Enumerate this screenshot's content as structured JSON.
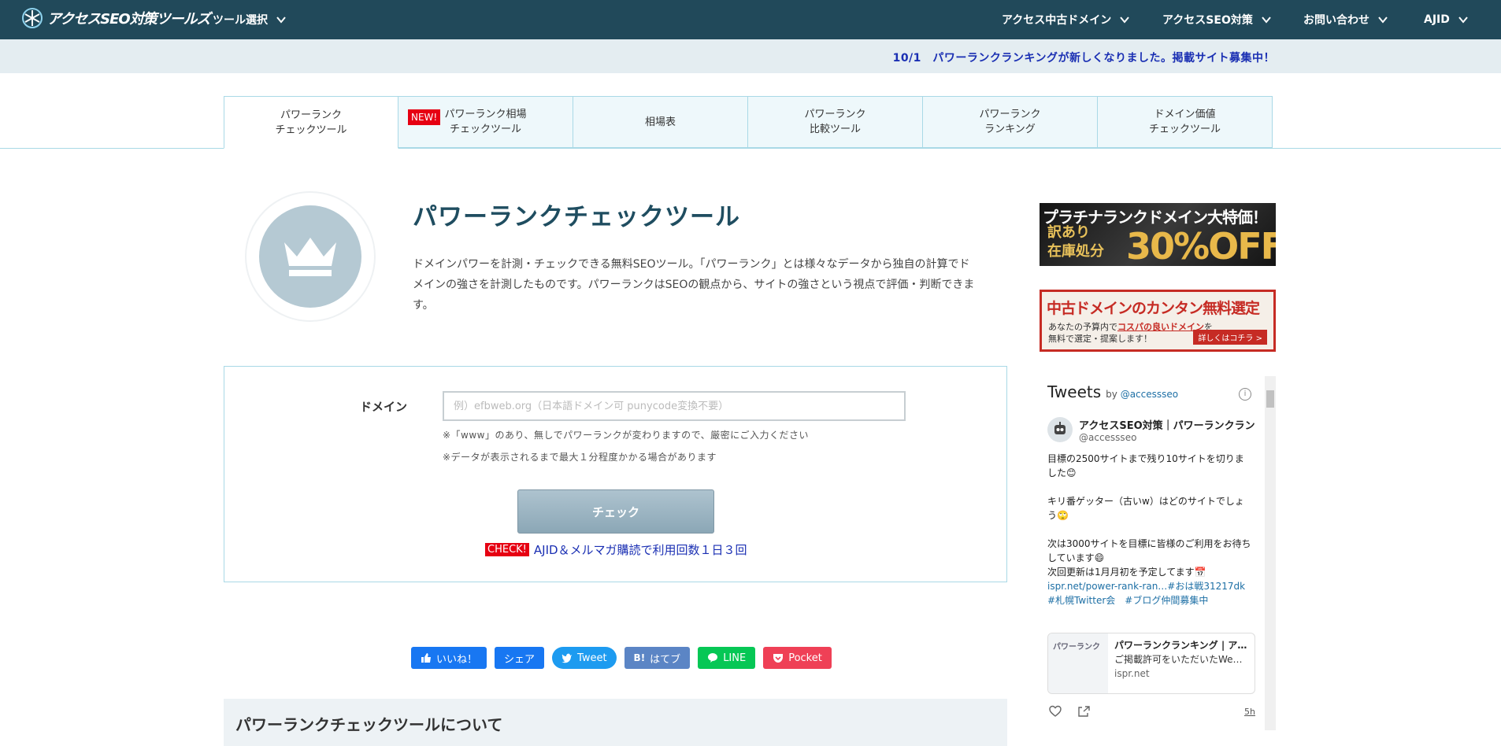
{
  "header": {
    "logo_text": "アクセスSEO対策ツールズ",
    "tool_select": "ツール選択",
    "nav": [
      "アクセス中古ドメイン",
      "アクセスSEO対策",
      "お問い合わせ",
      "AJID"
    ]
  },
  "notice": "10/1　パワーランクランキングが新しくなりました。掲載サイト募集中！",
  "tabs": [
    {
      "label": "パワーランク\nチェックツール",
      "active": true
    },
    {
      "label": "パワーランク相場\nチェックツール",
      "badge": "NEW!"
    },
    {
      "label": "相場表"
    },
    {
      "label": "パワーランク\n比較ツール"
    },
    {
      "label": "パワーランク\nランキング"
    },
    {
      "label": "ドメイン価値\nチェックツール"
    }
  ],
  "hero": {
    "title": "パワーランクチェックツール",
    "description": "ドメインパワーを計測・チェックできる無料SEOツール。「パワーランク」とは様々なデータから独自の計算でドメインの強さを計測したものです。パワーランクはSEOの観点から、サイトの強さという視点で評価・判断できます。"
  },
  "form": {
    "label": "ドメイン",
    "value": "",
    "placeholder": "例）efbweb.org（日本語ドメイン可 punycode変換不要）",
    "note1": "※「www」のあり、無しでパワーランクが変わりますので、厳密にご入力ください",
    "note2": "※データが表示されるまで最大１分程度かかる場合があります",
    "button": "チェック",
    "check_badge": "CHECK!",
    "promo": "AJID＆メルマガ購読で利用回数１日３回"
  },
  "share": {
    "like": "いいね！",
    "share": "シェア",
    "tweet": "Tweet",
    "hatena": "はてブ",
    "hatena_mark": "B!",
    "line": "LINE",
    "pocket": "Pocket"
  },
  "about_title": "パワーランクチェックツールについて",
  "banner1": {
    "top": "プラチナランクドメイン大特価！",
    "left1": "訳あり",
    "left2": "在庫処分",
    "big": "30%OFF"
  },
  "banner2": {
    "title": "中古ドメインのカンタン無料選定",
    "sub_pre": "あなたの予算内で",
    "sub_em": "コスパの良いドメイン",
    "sub_post": "を",
    "sub_line2": "無料で選定・提案します！",
    "btn": "詳しくはコチラ >"
  },
  "tweets": {
    "title": "Tweets",
    "by": "by",
    "handle": "@accessseo",
    "author_name": "アクセスSEO対策｜パワーランクラン",
    "author_handle": "@accessseo",
    "p1": "目標の2500サイトまで残り10サイトを切りました😊",
    "p2": "キリ番ゲッター（古いw）はどのサイトでしょう🙄",
    "p3a": "次は3000サイトを目標に皆様のご利用をお待ちしています😄",
    "p3b": "次回更新は1月月初を予定してます📅",
    "p3c": "ispr.net/power-rank-ran…#おは戦31217dk　#札幌Twitter会　#ブログ仲間募集中",
    "card_img": "パワーランク",
    "card_title": "パワーランクランキング | ア…",
    "card_desc": "ご掲載許可をいただいたWe…",
    "card_domain": "ispr.net",
    "time": "5h"
  },
  "colors": {
    "header": "#21495a",
    "accent": "#1f4d60",
    "link": "#1a2fb3",
    "badge": "#e60012"
  }
}
